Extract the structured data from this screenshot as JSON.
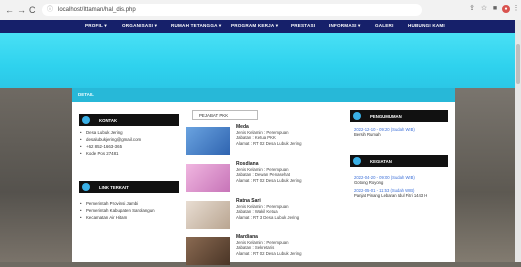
{
  "browser": {
    "url": "localhost/Ittaman/hal_dis.php",
    "back": "←",
    "forward": "→",
    "reload": "C"
  },
  "menu": [
    {
      "label": "PROFIL ▾"
    },
    {
      "label": "ORGANISASI ▾"
    },
    {
      "label": "RUMAH TETANGGA ▾"
    },
    {
      "label": "PROGRAM KERJA ▾"
    },
    {
      "label": "PRESTASI"
    },
    {
      "label": "INFORMASI ▾"
    },
    {
      "label": "GALERI"
    },
    {
      "label": "HUBUNGI KAMI"
    }
  ],
  "breadcrumb": "DETAIL",
  "kontak": {
    "title": "KONTAK",
    "items": [
      "Desa Lubuk Jering",
      "desalubukjering@gmail.com",
      "+62 852-1663-365",
      "Kode Pos 27481"
    ]
  },
  "links": {
    "title": "LINK TERKAIT",
    "items": [
      "Pemerintah Provinsi Jambi",
      "Pemerintah Kabupaten Sarolangun",
      "Kecamatan Air Hitam"
    ]
  },
  "pejabat": {
    "tab": "PEJABAT PKK",
    "people": [
      {
        "name": "Meda",
        "jk": "Jenis Kelamin : Perempuan",
        "jabatan": "Jabatan : Ketua PKK",
        "alamat": "Alamat : RT 02 Desa Lubuk Jering",
        "photo": "#3a7bc8"
      },
      {
        "name": "Rosdiana",
        "jk": "Jenis Kelamin : Perempuan",
        "jabatan": "Jabatan : Dewan Penasehat",
        "alamat": "Alamat : RT 02 Desa Lubuk Jering",
        "photo": "#e29ad1"
      },
      {
        "name": "Ratna Sari",
        "jk": "Jenis Kelamin : Perempuan",
        "jabatan": "Jabatan : Wakil Ketua",
        "alamat": "Alamat : RT 3 Desa Lubuk Jering",
        "photo": "#d7c8b8"
      },
      {
        "name": "Mardiana",
        "jk": "Jenis Kelamin : Perempuan",
        "jabatan": "Jabatan : Sekretaris",
        "alamat": "Alamat : RT 02 Desa Lubuk Jering",
        "photo": "#6b4e3a"
      }
    ]
  },
  "pengumuman": {
    "title": "PENGUMUMAN",
    "items": [
      {
        "date": "2022-12-10 - 09:20 (Sudah WIB)",
        "title": "Bersih Rumah"
      }
    ]
  },
  "kegiatan": {
    "title": "KEGIATAN",
    "items": [
      {
        "date": "2022-04-20 - 09:00 (Sudah WIB)",
        "title": "Gotong Royong"
      },
      {
        "date": "2022-05-01 - 11:53 (Sudah WIB)",
        "title": "Panjat Pinang Lebaran Idul Fitri 1443 H"
      }
    ]
  }
}
